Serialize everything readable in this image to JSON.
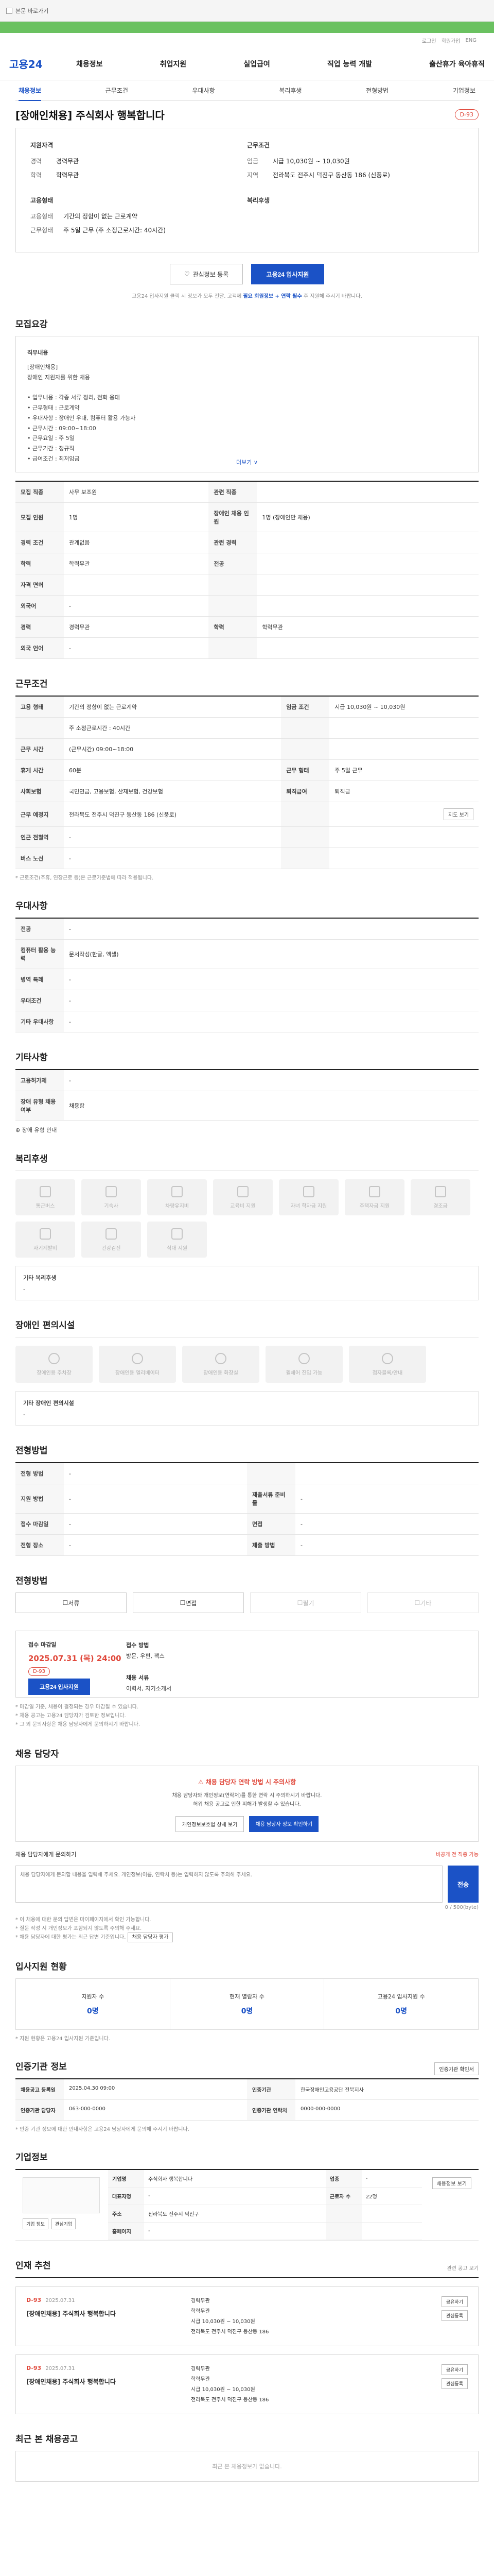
{
  "topbar": {
    "skip_text": "본문 바로가기",
    "checkbox_label": "고용24 내 검색"
  },
  "util": {
    "items": [
      "로그인",
      "회원가입",
      "ENG"
    ]
  },
  "gnb": {
    "logo": "고용24",
    "menus": [
      "채용정보",
      "취업지원",
      "실업급여",
      "직업 능력 개발",
      "출산휴가 육아휴직"
    ]
  },
  "subtabs": [
    "채용정보",
    "근무조건",
    "우대사항",
    "복리후생",
    "전형방법",
    "기업정보"
  ],
  "title": {
    "text": "[장애인채용] 주식회사 행복합니다",
    "dday": "D-93"
  },
  "summary": {
    "left_head": "지원자격",
    "left": [
      {
        "k": "경력",
        "v": "경력무관"
      },
      {
        "k": "학력",
        "v": "학력무관"
      }
    ],
    "left2_head": "고용형태",
    "left2": [
      {
        "k": "고용형태",
        "v": "기간의 정함이 없는 근로계약"
      },
      {
        "k": "근무형태",
        "v": "주 5일 근무 (주 소정근로시간: 40시간)"
      }
    ],
    "right_head": "근무조건",
    "right": [
      {
        "k": "임금",
        "v": "시급 10,030원 ~ 10,030원"
      },
      {
        "k": "지역",
        "v": "전라북도 전주시 덕진구 동산동 186 (신풍로)"
      }
    ],
    "right2_head": "복리후생"
  },
  "actions": {
    "bookmark": "관심정보 등록",
    "apply": "고용24 입사지원",
    "notice_pre": "고용24 입사지원 클릭 시 정보가 모두 전달. 고객께 ",
    "notice_blue": "필요 회원정보 + 연락 필수",
    "notice_post": " 후 지원해 주시기 바랍니다."
  },
  "detail": {
    "title": "모집요강",
    "head": "직무내용",
    "lines": [
      "[장애인채용]",
      "장애인 지원자를 위한 채용",
      "",
      "• 업무내용 : 각종 서류 정리, 전화 응대",
      "• 근무형태 : 근로계약",
      "• 우대사항 : 장애인 우대, 컴퓨터 활용 가능자",
      "• 근무시간 : 09:00~18:00",
      "• 근무요일 : 주 5일",
      "• 근무기간 : 정규직",
      "• 급여조건 : 최저임금"
    ],
    "more": "더보기 ∨"
  },
  "recruit_table": [
    [
      {
        "k": "모집 직종",
        "v": "사무 보조원"
      },
      {
        "k": "관련 직종",
        "v": ""
      }
    ],
    [
      {
        "k": "모집 인원",
        "v": "1명"
      },
      {
        "k": "장애인 채용 인원",
        "v": "1명 (장애인만 채용)"
      }
    ],
    [
      {
        "k": "경력 조건",
        "v": "관계없음"
      },
      {
        "k": "관련 경력",
        "v": ""
      }
    ],
    [
      {
        "k": "학력",
        "v": "학력무관"
      },
      {
        "k": "전공",
        "v": ""
      }
    ],
    [
      {
        "k": "자격 면허",
        "v": ""
      },
      {
        "k": "",
        "v": ""
      }
    ],
    [
      {
        "k": "외국어",
        "v": "-"
      },
      {
        "k": "",
        "v": ""
      }
    ],
    [
      {
        "k": "경력",
        "v": "경력무관"
      },
      {
        "k": "학력",
        "v": "학력무관"
      }
    ],
    [
      {
        "k": "외국 언어",
        "v": "-"
      },
      {
        "k": "",
        "v": ""
      }
    ]
  ],
  "work": {
    "title": "근무조건",
    "rows": [
      {
        "k": "고용 형태",
        "v": "기간의 정함이 없는 근로계약",
        "k2": "임금 조건",
        "v2": "시급 10,030원 ~ 10,030원"
      },
      {
        "k": "",
        "v": "주 소정근로시간 : 40시간",
        "k2": "",
        "v2": ""
      },
      {
        "k": "근무 시간",
        "v": "(근무시간) 09:00~18:00",
        "k2": "",
        "v2": ""
      },
      {
        "k": "휴게 시간",
        "v": "60분",
        "k2": "근무 형태",
        "v2": "주 5일 근무"
      },
      {
        "k": "사회보험",
        "v": "국민연금, 고용보험, 산재보험, 건강보험",
        "k2": "퇴직급여",
        "v2": "퇴직금"
      },
      {
        "k": "근무 예정지",
        "v": "전라북도 전주시 덕진구 동산동 186 (신풍로)",
        "k2": "",
        "v2": ""
      },
      {
        "k": "인근 전철역",
        "v": "-",
        "k2": "",
        "v2": ""
      },
      {
        "k": "버스 노선",
        "v": "-",
        "k2": "",
        "v2": ""
      }
    ],
    "map_btn": "지도 보기",
    "note": "* 근로조건(주휴, 연장근로 등)은 근로기준법에 따라 적용됩니다."
  },
  "prefer": {
    "title": "우대사항",
    "rows": [
      {
        "k": "전공",
        "v": "-"
      },
      {
        "k": "컴퓨터 활용 능력",
        "v": "문서작성(한글, 엑셀)"
      },
      {
        "k": "병역 특례",
        "v": "-"
      },
      {
        "k": "우대조건",
        "v": "-"
      },
      {
        "k": "기타 우대사항",
        "v": "-"
      }
    ]
  },
  "extra": {
    "title": "기타사항",
    "rows": [
      {
        "k": "고용허가제",
        "v": "-"
      },
      {
        "k": "장애 유형 채용 여부",
        "v": "채용함"
      }
    ],
    "link": "장애 유형 안내"
  },
  "welfare": {
    "title": "복리후생",
    "tiles": [
      "통근버스",
      "기숙사",
      "차량유지비",
      "교육비 지원",
      "자녀 학자금 지원",
      "주택자금 지원",
      "경조금",
      "자기계발비",
      "건강검진",
      "식대 지원"
    ],
    "other_head": "기타 복리후생",
    "other_val": "-"
  },
  "disability": {
    "title": "장애인 편의시설",
    "tiles": [
      "장애인용 주차장",
      "장애인용 엘리베이터",
      "장애인용 화장실",
      "휠체어 진입 가능",
      "점자블록/안내"
    ],
    "other_head": "기타 장애인 편의시설",
    "other_val": "-"
  },
  "method": {
    "title": "전형방법",
    "rows": [
      {
        "k": "전형 방법",
        "v": "-",
        "k2": "",
        "v2": ""
      },
      {
        "k": "지원 방법",
        "v": "-",
        "k2": "제출서류 준비물",
        "v2": "-"
      },
      {
        "k": "접수 마감일",
        "v": "-",
        "k2": "면접",
        "v2": "-"
      },
      {
        "k": "전형 장소",
        "v": "-",
        "k2": "제출 방법",
        "v2": "-"
      }
    ]
  },
  "contract": {
    "title": "전형방법",
    "opts": [
      "서류",
      "면접",
      "필기",
      "기타"
    ]
  },
  "apply": {
    "col1_label": "접수 마감일",
    "col1_value": "2025.07.31 (목) 24:00",
    "col1_status": "D-93",
    "col1_btn": "고용24 입사지원",
    "col2_head": "접수 방법",
    "col2_lines": [
      "방문, 우편, 팩스",
      "",
      "채용 서류",
      "이력서, 자기소개서"
    ],
    "notes": [
      "* 마감일 기준, 채용이 결정되는 경우 마감될 수 있습니다.",
      "* 채용 공고는 고용24 담당자가 검토한 정보입니다.",
      "* 그 외 문의사항은 채용 담당자에게 문의하시기 바랍니다."
    ]
  },
  "contact": {
    "title": "채용 담당자",
    "warn": "채용 담당자 연락 방법 시 주의사항",
    "text1": "채용 담당자와 개인정보(연락처)를 통한 연락 시 주의하시기 바랍니다.",
    "text2": "허위 채용 공고로 인한 피해가 발생할 수 있습니다.",
    "btn1": "개인정보보호법 상세 보기",
    "btn2": "채용 담당자 정보 확인하기",
    "qa_label": "채용 담당자에게 문의하기",
    "qa_count": "0 / 500(byte)",
    "qa_right": "비공개 전 직종 가능",
    "qa_placeholder": "채용 담당자에게 문의할 내용을 입력해 주세요. 개인정보(이름, 연락처 등)는 입력하지 않도록 주의해 주세요.",
    "qa_send": "전송",
    "notes": [
      "* 이 채용에 대한 문의 답변은 마이페이지에서 확인 가능합니다.",
      "* 질문 작성 시 개인정보가 포함되지 않도록 주의해 주세요.",
      "* 채용 담당자에 대한 평가는 최근 답변 기준입니다."
    ],
    "notes_btn": "채용 담당자 평가"
  },
  "status": {
    "title": "입사지원 현황",
    "cells": [
      {
        "label": "지원자 수",
        "num": "0명"
      },
      {
        "label": "현재 열람자 수",
        "num": "0명"
      },
      {
        "label": "고용24 입사지원 수",
        "num": "0명"
      }
    ],
    "note": "* 지원 현황은 고용24 입사지원 기준입니다."
  },
  "auth": {
    "title": "인증기관 정보",
    "print_btn": "인증기관 확인서",
    "rows": [
      {
        "k": "채용공고 등록일",
        "v": "2025.04.30 09:00",
        "k2": "인증기관",
        "v2": "한국장애인고용공단 전북지사"
      },
      {
        "k": "인증기관 담당자",
        "v": "063-000-0000",
        "k2": "인증기관 연락처",
        "v2": "0000-000-0000"
      }
    ],
    "note": "* 인증 기관 정보에 대한 안내사항은 고용24 담당자에게 문의해 주시기 바랍니다."
  },
  "company": {
    "title": "기업정보",
    "btn1": "기업 정보",
    "btn2": "관심기업",
    "rows": [
      {
        "k": "기업명",
        "v": "주식회사 행복합니다",
        "k2": "업종",
        "v2": "-"
      },
      {
        "k": "대표자명",
        "v": "-",
        "k2": "근로자 수",
        "v2": "22명"
      },
      {
        "k": "주소",
        "v": "전라북도 전주시 덕진구",
        "k2": "",
        "v2": ""
      },
      {
        "k": "홈페이지",
        "v": "-",
        "k2": "",
        "v2": ""
      }
    ],
    "side_btn": "채용정보 보기"
  },
  "others": {
    "title": "인재 추천",
    "right": "관련 공고 보기",
    "cards": [
      {
        "dday": "D-93",
        "date": "2025.07.31",
        "title": "[장애인채용] 주식회사 행복합니다",
        "meta": [
          "경력무관",
          "학력무관",
          "시급 10,030원 ~ 10,030원",
          "전라북도 전주시 덕진구 동산동 186"
        ],
        "btns": [
          "공유하기",
          "관심등록"
        ]
      },
      {
        "dday": "D-93",
        "date": "2025.07.31",
        "title": "[장애인채용] 주식회사 행복합니다",
        "meta": [
          "경력무관",
          "학력무관",
          "시급 10,030원 ~ 10,030원",
          "전라북도 전주시 덕진구 동산동 186"
        ],
        "btns": [
          "공유하기",
          "관심등록"
        ]
      }
    ]
  },
  "recent": {
    "title": "최근 본 채용공고",
    "empty": "최근 본 채용정보가 없습니다."
  },
  "colors": {
    "brand": "#1b52c6",
    "accent": "#e0473a",
    "green": "#6ac160"
  }
}
